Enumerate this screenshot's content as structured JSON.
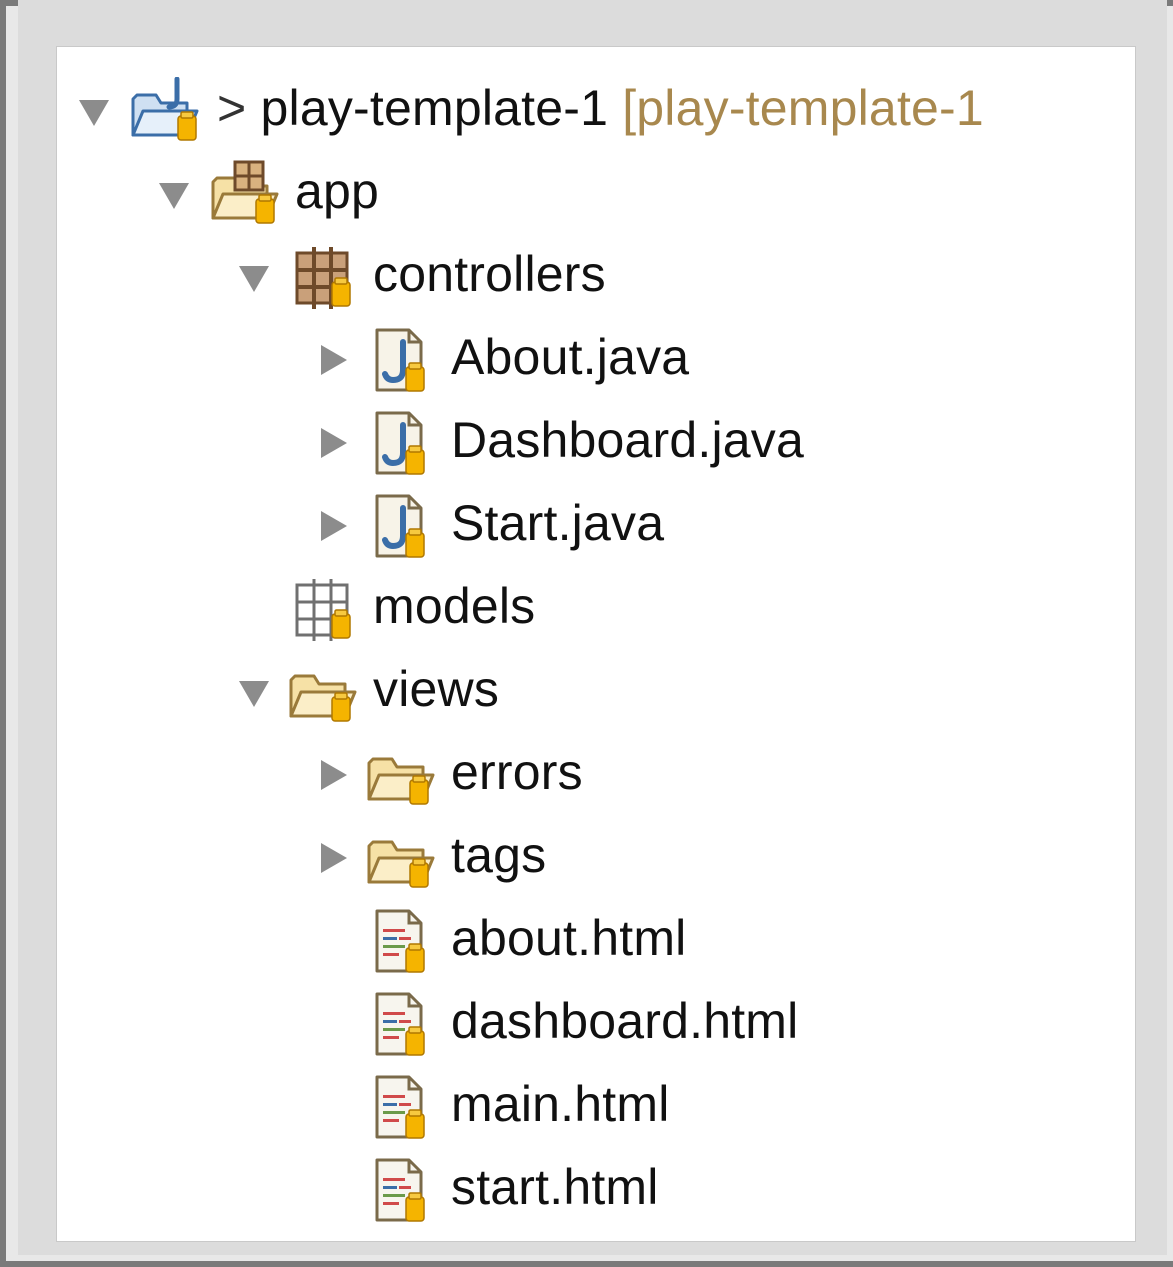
{
  "tree": {
    "project": {
      "prefix": ">",
      "name": "play-template-1",
      "decoration": "[play-template-1",
      "expanded": true,
      "icon": "java-project-folder-icon"
    },
    "app": {
      "label": "app",
      "expanded": true,
      "icon": "source-folder-icon"
    },
    "controllers": {
      "label": "controllers",
      "expanded": true,
      "icon": "package-icon",
      "files": [
        {
          "label": "About.java",
          "expanded": false,
          "icon": "java-file-icon"
        },
        {
          "label": "Dashboard.java",
          "expanded": false,
          "icon": "java-file-icon"
        },
        {
          "label": "Start.java",
          "expanded": false,
          "icon": "java-file-icon"
        }
      ]
    },
    "models": {
      "label": "models",
      "icon": "empty-package-icon"
    },
    "views": {
      "label": "views",
      "expanded": true,
      "icon": "folder-icon",
      "folders": [
        {
          "label": "errors",
          "expanded": false,
          "icon": "folder-icon"
        },
        {
          "label": "tags",
          "expanded": false,
          "icon": "folder-icon"
        }
      ],
      "files": [
        {
          "label": "about.html",
          "icon": "html-file-icon"
        },
        {
          "label": "dashboard.html",
          "icon": "html-file-icon"
        },
        {
          "label": "main.html",
          "icon": "html-file-icon"
        },
        {
          "label": "start.html",
          "icon": "html-file-icon"
        }
      ]
    }
  },
  "colors": {
    "decoration": "#a8884e",
    "java_blue": "#3b6ea8",
    "folder_fill": "#f6e1a6",
    "folder_stroke": "#9a7a3a",
    "overlay_orange": "#f5b400",
    "twisty": "#8c8c8c"
  }
}
